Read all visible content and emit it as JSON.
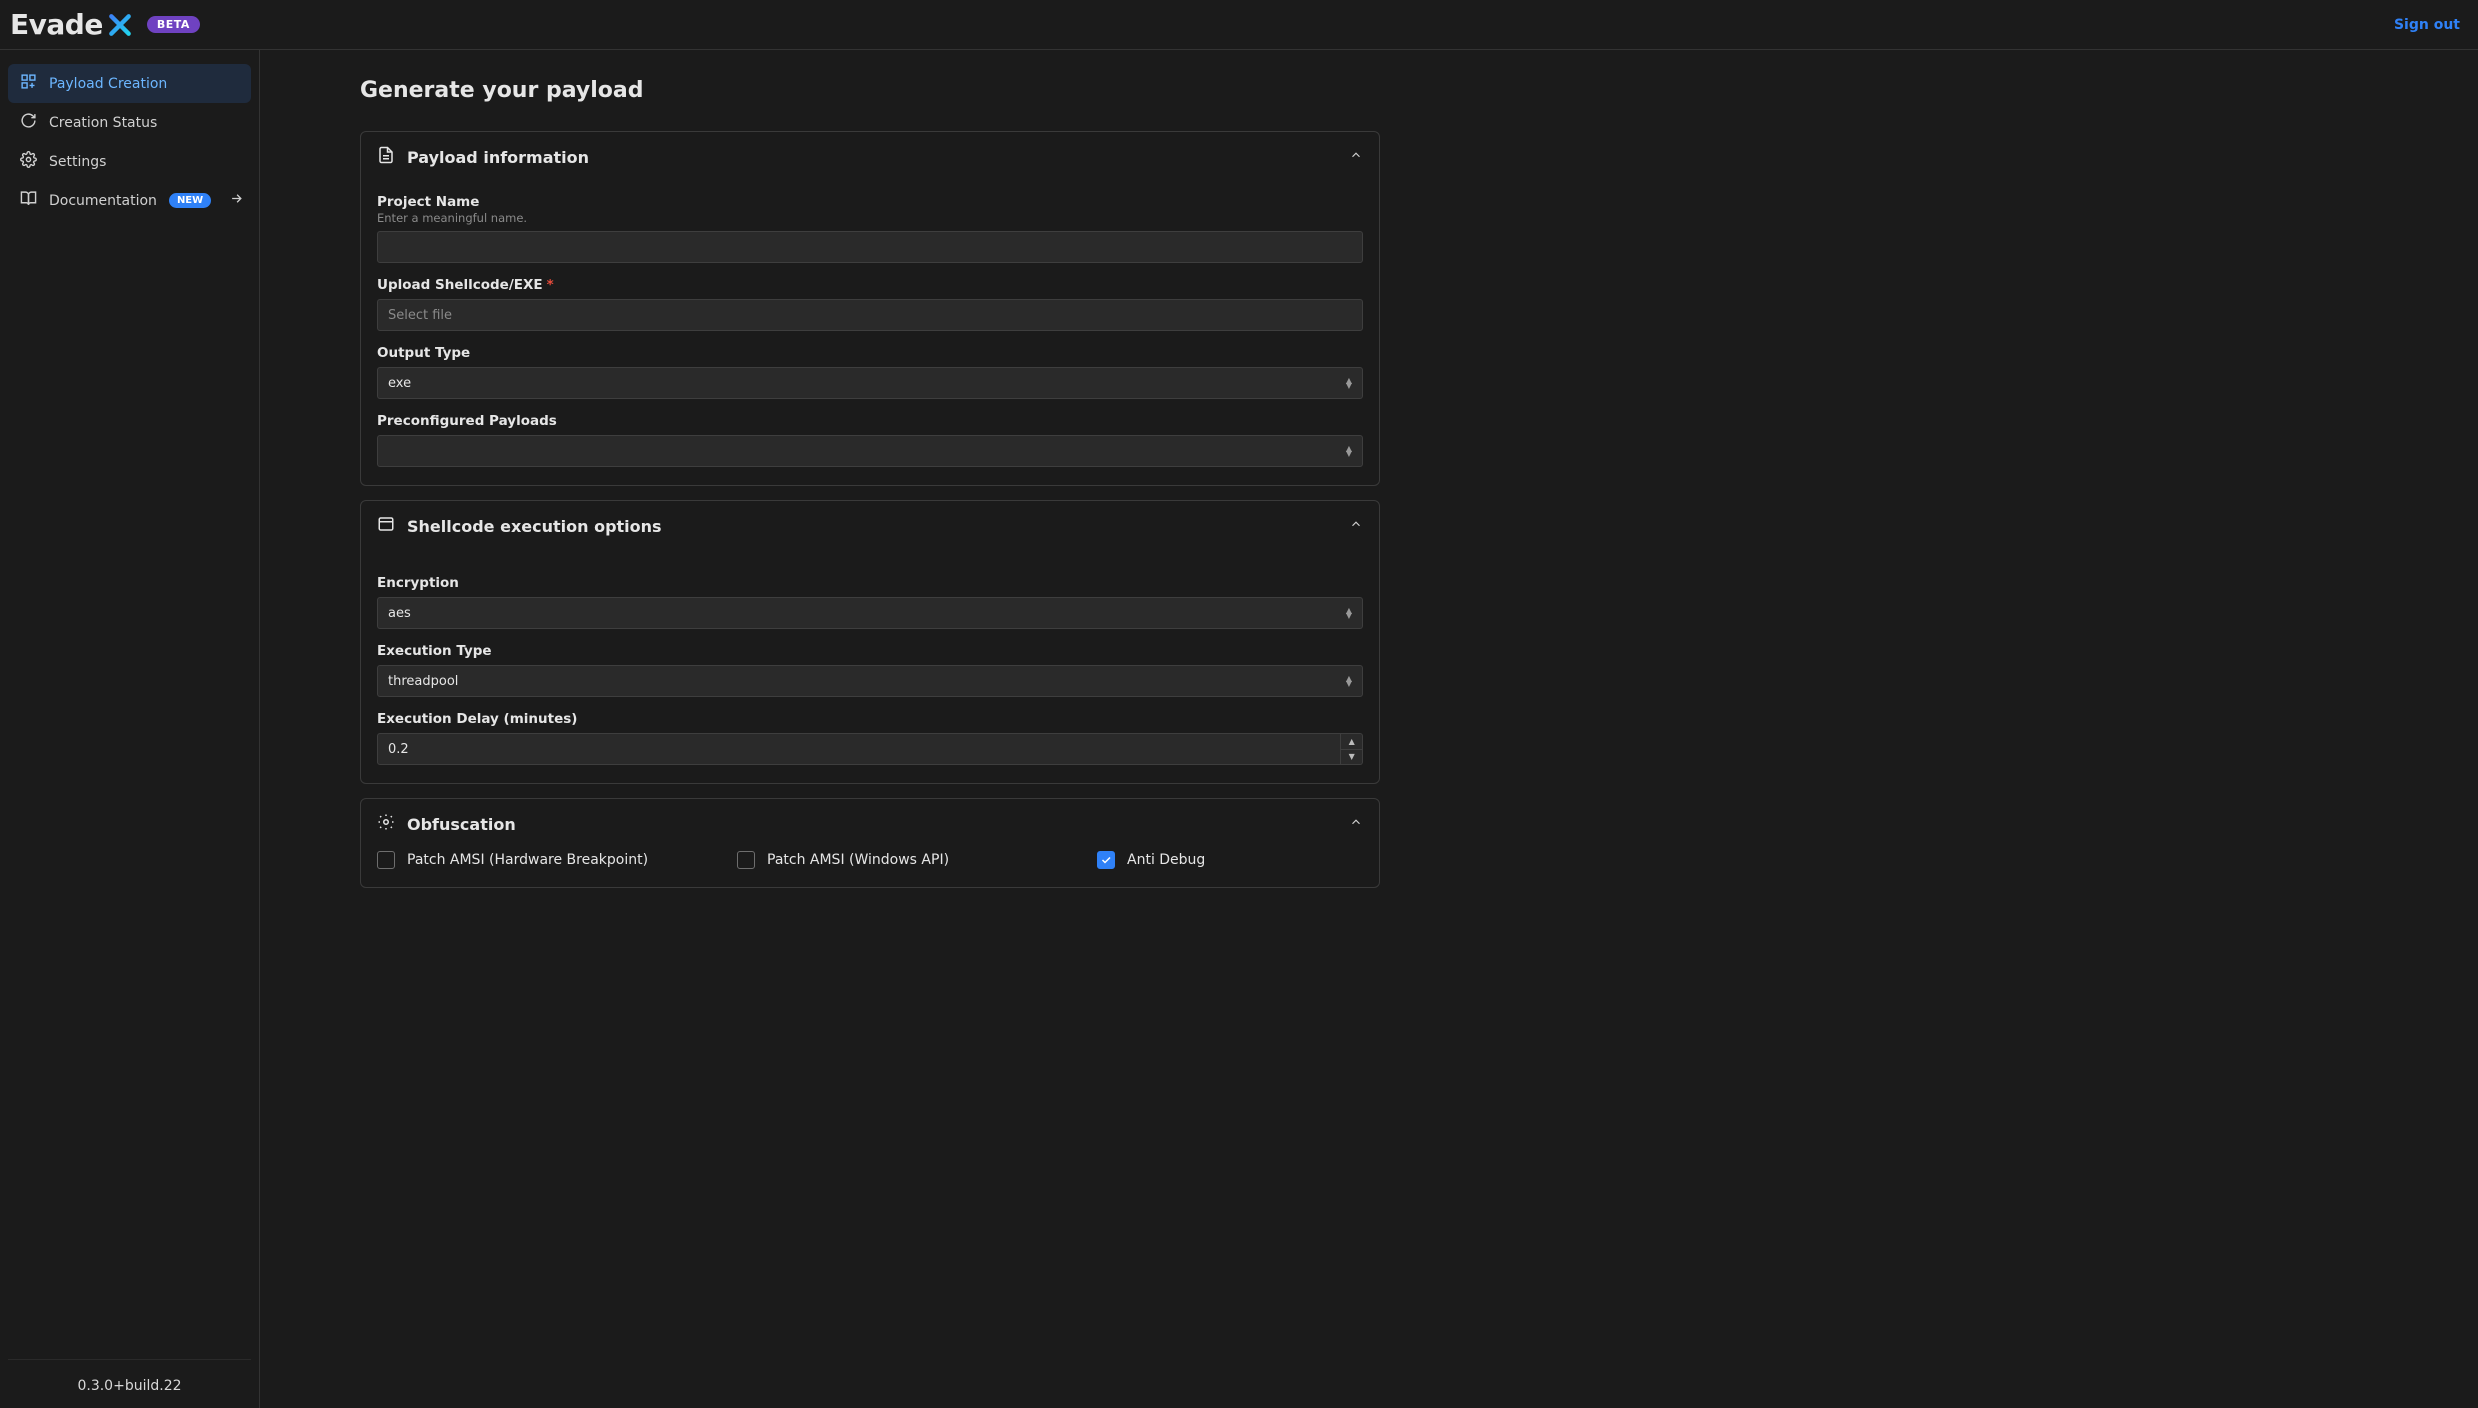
{
  "brand": {
    "name": "Evade",
    "badge": "BETA"
  },
  "header": {
    "sign_out": "Sign out"
  },
  "sidebar": {
    "items": [
      {
        "label": "Payload Creation",
        "active": true
      },
      {
        "label": "Creation Status"
      },
      {
        "label": "Settings"
      },
      {
        "label": "Documentation",
        "badge": "NEW",
        "external": true
      }
    ],
    "version": "0.3.0+build.22"
  },
  "page": {
    "title": "Generate your payload"
  },
  "panels": {
    "payload_info": {
      "title": "Payload information",
      "project_name": {
        "label": "Project Name",
        "help": "Enter a meaningful name.",
        "value": ""
      },
      "upload": {
        "label": "Upload Shellcode/EXE",
        "required": true,
        "placeholder": "Select file"
      },
      "output_type": {
        "label": "Output Type",
        "value": "exe"
      },
      "preconfigured": {
        "label": "Preconfigured Payloads",
        "value": ""
      }
    },
    "exec": {
      "title": "Shellcode execution options",
      "encryption": {
        "label": "Encryption",
        "value": "aes"
      },
      "exec_type": {
        "label": "Execution Type",
        "value": "threadpool"
      },
      "delay": {
        "label": "Execution Delay (minutes)",
        "value": "0.2"
      }
    },
    "obf": {
      "title": "Obfuscation",
      "opts": [
        {
          "label": "Patch AMSI (Hardware Breakpoint)",
          "checked": false
        },
        {
          "label": "Patch AMSI (Windows API)",
          "checked": false
        },
        {
          "label": "Anti Debug",
          "checked": true
        }
      ]
    }
  }
}
